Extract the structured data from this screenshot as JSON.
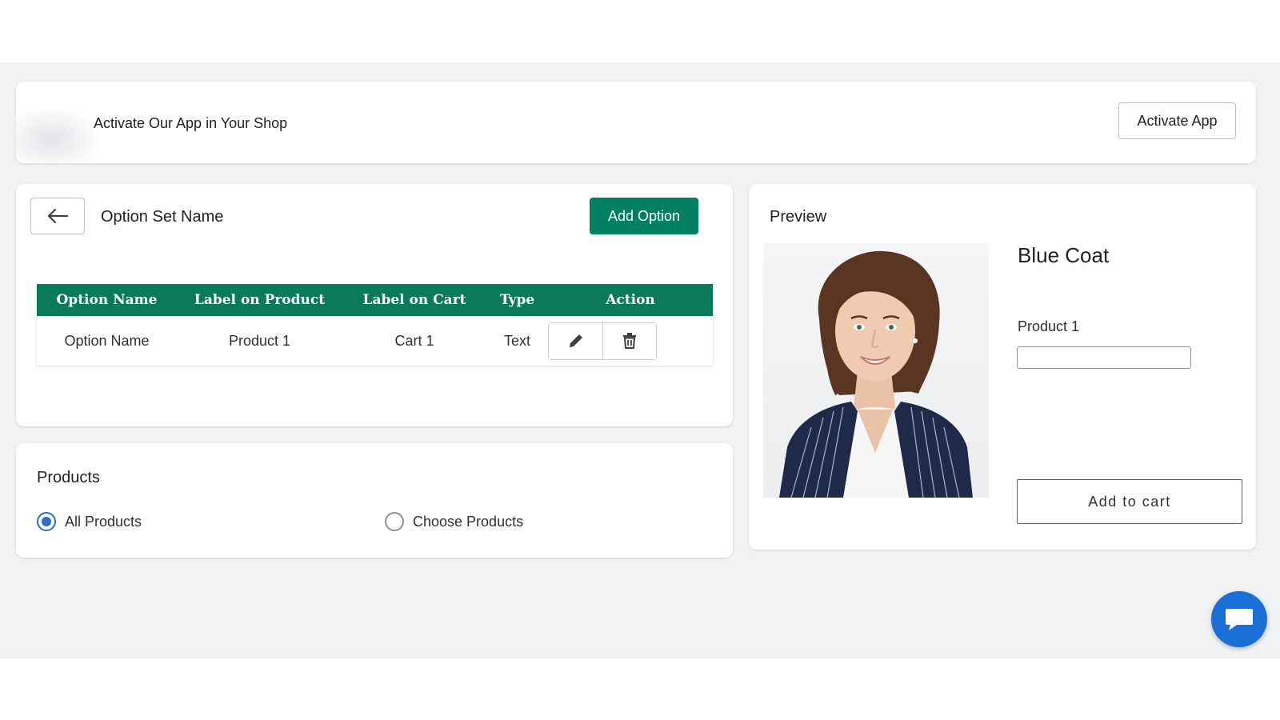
{
  "banner": {
    "text": "Activate Our App in Your Shop",
    "button_label": "Activate App"
  },
  "option_set": {
    "title": "Option Set Name",
    "add_button_label": "Add Option",
    "table": {
      "headers": [
        "Option Name",
        "Label on Product",
        "Label on Cart",
        "Type",
        "Action"
      ],
      "rows": [
        {
          "option_name": "Option Name",
          "label_on_product": "Product 1",
          "label_on_cart": "Cart 1",
          "type": "Text"
        }
      ]
    }
  },
  "products": {
    "title": "Products",
    "options": [
      {
        "label": "All Products",
        "selected": true
      },
      {
        "label": "Choose Products",
        "selected": false
      }
    ]
  },
  "preview": {
    "title": "Preview",
    "product_name": "Blue Coat",
    "field_label": "Product 1",
    "field_value": "",
    "cart_button_label": "Add to cart"
  },
  "colors": {
    "primary": "#008060",
    "table_header": "#0a7a59",
    "radio_selected": "#2c6ecb",
    "chat_bubble": "#1a6fd6",
    "app_background": "#f1f2f4"
  },
  "icons": {
    "back": "arrow-left-icon",
    "edit": "pencil-icon",
    "delete": "trash-icon",
    "chat": "chat-bubble-icon"
  }
}
